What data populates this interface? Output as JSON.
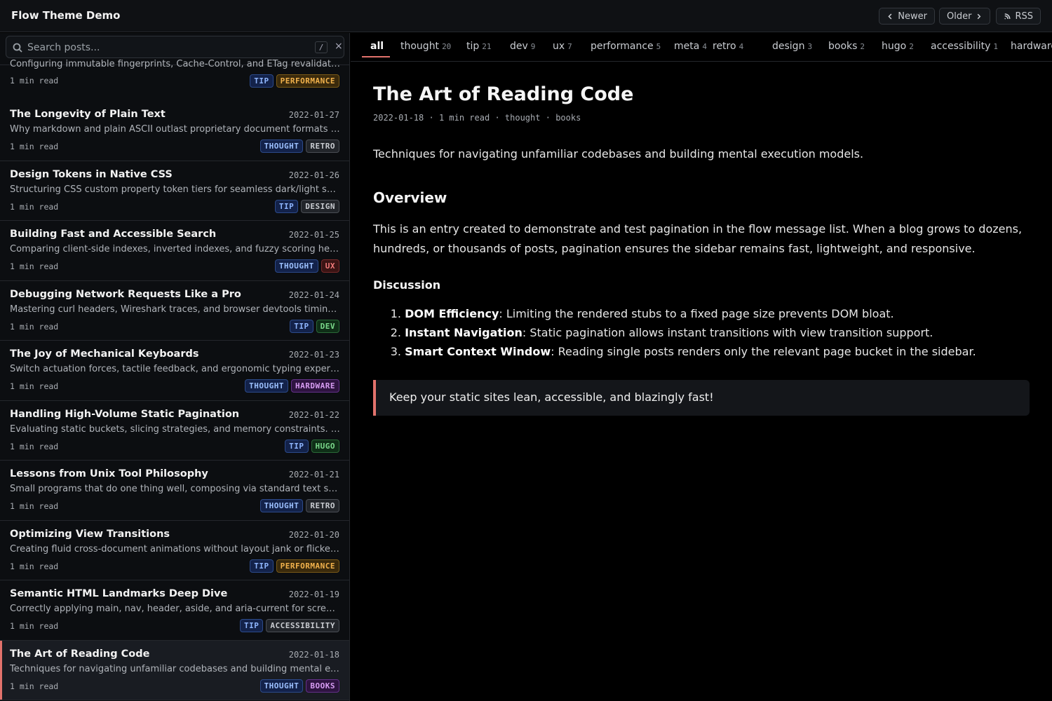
{
  "header": {
    "title": "Flow Theme Demo",
    "newer_label": "Newer",
    "older_label": "Older",
    "rss_label": "RSS"
  },
  "search": {
    "placeholder": "Search posts...",
    "shortcut": "/",
    "clear": "×"
  },
  "sidebar": {
    "partial_post": {
      "description": "Configuring immutable fingerprints, Cache-Control, and ETag revalidation strategies",
      "read_time": "1 min read",
      "tags": [
        "TIP",
        "PERFORMANCE"
      ]
    },
    "posts": [
      {
        "title": "The Longevity of Plain Text",
        "date": "2022-01-27",
        "description": "Why markdown and plain ASCII outlast proprietary document formats by decades.",
        "read_time": "1 min read",
        "tags": [
          "THOUGHT",
          "RETRO"
        ]
      },
      {
        "title": "Design Tokens in Native CSS",
        "date": "2022-01-26",
        "description": "Structuring CSS custom property token tiers for seamless dark/light switching.",
        "read_time": "1 min read",
        "tags": [
          "TIP",
          "DESIGN"
        ]
      },
      {
        "title": "Building Fast and Accessible Search",
        "date": "2022-01-25",
        "description": "Comparing client-side indexes, inverted indexes, and fuzzy scoring heuristics.",
        "read_time": "1 min read",
        "tags": [
          "THOUGHT",
          "UX"
        ]
      },
      {
        "title": "Debugging Network Requests Like a Pro",
        "date": "2022-01-24",
        "description": "Mastering curl headers, Wireshark traces, and browser devtools timing waterfalls.",
        "read_time": "1 min read",
        "tags": [
          "TIP",
          "DEV"
        ]
      },
      {
        "title": "The Joy of Mechanical Keyboards",
        "date": "2022-01-23",
        "description": "Switch actuation forces, tactile feedback, and ergonomic typing experiences.",
        "read_time": "1 min read",
        "tags": [
          "THOUGHT",
          "HARDWARE"
        ]
      },
      {
        "title": "Handling High-Volume Static Pagination",
        "date": "2022-01-22",
        "description": "Evaluating static buckets, slicing strategies, and memory constraints. Overview.",
        "read_time": "1 min read",
        "tags": [
          "TIP",
          "HUGO"
        ]
      },
      {
        "title": "Lessons from Unix Tool Philosophy",
        "date": "2022-01-21",
        "description": "Small programs that do one thing well, composing via standard text streams.",
        "read_time": "1 min read",
        "tags": [
          "THOUGHT",
          "RETRO"
        ]
      },
      {
        "title": "Optimizing View Transitions",
        "date": "2022-01-20",
        "description": "Creating fluid cross-document animations without layout jank or flicker. Overview.",
        "read_time": "1 min read",
        "tags": [
          "TIP",
          "PERFORMANCE"
        ]
      },
      {
        "title": "Semantic HTML Landmarks Deep Dive",
        "date": "2022-01-19",
        "description": "Correctly applying main, nav, header, aside, and aria-current for screen readers.",
        "read_time": "1 min read",
        "tags": [
          "TIP",
          "ACCESSIBILITY"
        ]
      },
      {
        "title": "The Art of Reading Code",
        "date": "2022-01-18",
        "description": "Techniques for navigating unfamiliar codebases and building mental execution models.",
        "read_time": "1 min read",
        "tags": [
          "THOUGHT",
          "BOOKS"
        ],
        "active": true
      }
    ]
  },
  "tabs": [
    {
      "label": "all",
      "count": "",
      "active": true
    },
    {
      "label": "thought",
      "count": "20"
    },
    {
      "label": "tip",
      "count": "21"
    },
    {
      "label": "dev",
      "count": "9"
    },
    {
      "label": "ux",
      "count": "7"
    },
    {
      "label": "performance",
      "count": "5"
    },
    {
      "label": "meta",
      "count": "4"
    },
    {
      "label": "retro",
      "count": "4"
    },
    {
      "label": "design",
      "count": "3"
    },
    {
      "label": "books",
      "count": "2"
    },
    {
      "label": "hugo",
      "count": "2"
    },
    {
      "label": "accessibility",
      "count": "1"
    },
    {
      "label": "hardware",
      "count": ""
    }
  ],
  "article": {
    "title": "The Art of Reading Code",
    "date": "2022-01-18",
    "read_time": "1 min read",
    "tag1": "thought",
    "tag2": "books",
    "separator": "·",
    "intro": "Techniques for navigating unfamiliar codebases and building mental execution models.",
    "h2": "Overview",
    "paragraph": "This is an entry created to demonstrate and test pagination in the flow message list. When a blog grows to dozens, hundreds, or thousands of posts, pagination ensures the sidebar remains fast, lightweight, and responsive.",
    "h3": "Discussion",
    "list": [
      {
        "num": "1.",
        "term": "DOM Efficiency",
        "text": ": Limiting the rendered stubs to a fixed page size prevents DOM bloat."
      },
      {
        "num": "2.",
        "term": "Instant Navigation",
        "text": ": Static pagination allows instant transitions with view transition support."
      },
      {
        "num": "3.",
        "term": "Smart Context Window",
        "text": ": Reading single posts renders only the relevant page bucket in the sidebar."
      }
    ],
    "quote": "Keep your static sites lean, accessible, and blazingly fast!"
  },
  "colors": {
    "accent": "#e2726c",
    "background": "#000000",
    "sidebar_bg": "#0c0e11"
  },
  "icons": {
    "search": "search-icon",
    "newer": "chevron-left-icon",
    "older": "chevron-right-icon",
    "rss": "rss-icon"
  }
}
